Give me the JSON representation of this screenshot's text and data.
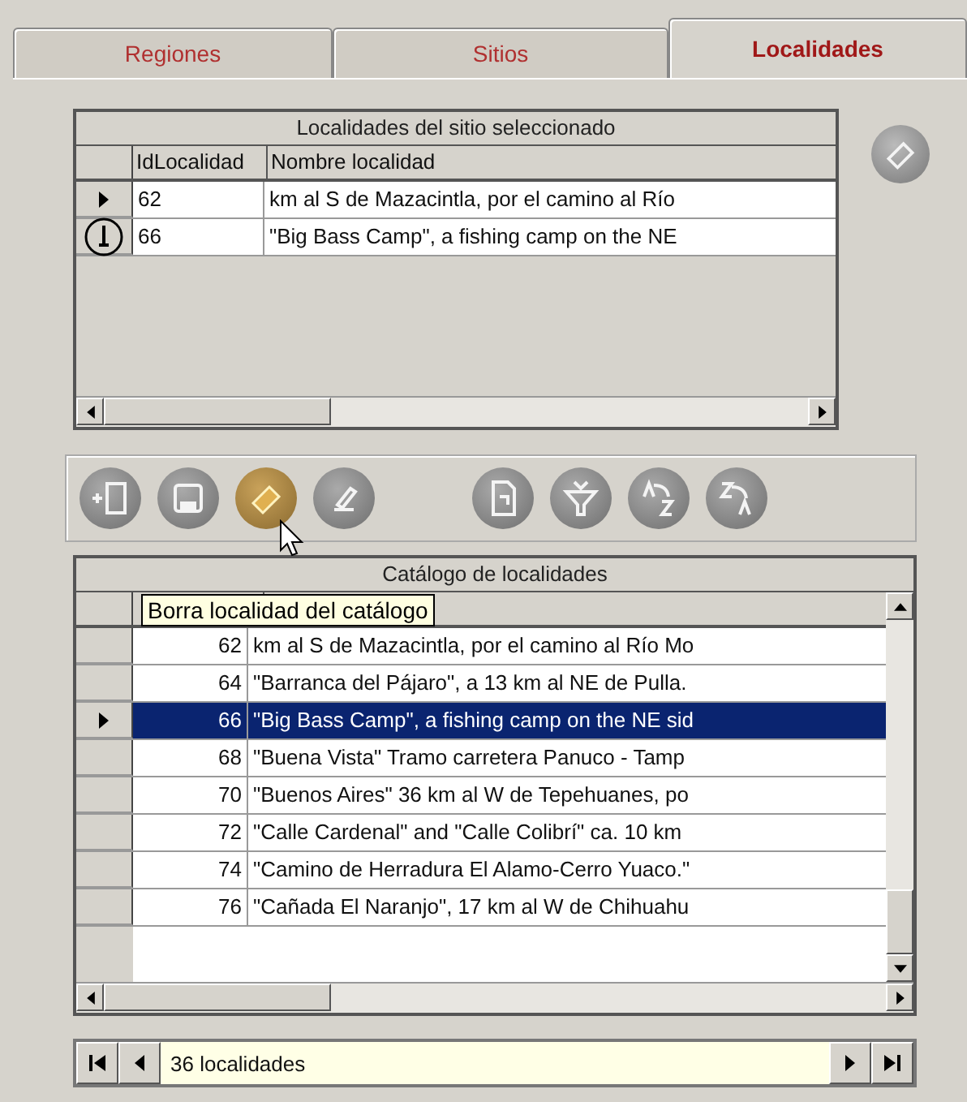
{
  "tabs": [
    {
      "label": "Regiones",
      "selected": false
    },
    {
      "label": "Sitios",
      "selected": false
    },
    {
      "label": "Localidades",
      "selected": true
    }
  ],
  "site_grid": {
    "title": "Localidades del sitio seleccionado",
    "columns": [
      "IdLocalidad",
      "Nombre localidad"
    ],
    "rows": [
      {
        "current": true,
        "cursor_over": false,
        "id": "62",
        "name": "km al S de Mazacintla, por el camino al Río"
      },
      {
        "current": false,
        "cursor_over": true,
        "id": "66",
        "name": "\"Big Bass Camp\", a fishing camp on the NE"
      }
    ]
  },
  "toolbar": [
    {
      "kind": "add",
      "hovered": false
    },
    {
      "kind": "save",
      "hovered": false
    },
    {
      "kind": "erase",
      "hovered": true
    },
    {
      "kind": "edit",
      "hovered": false
    },
    {
      "kind": "document",
      "hovered": false
    },
    {
      "kind": "filter",
      "hovered": false
    },
    {
      "kind": "sort_asc",
      "hovered": false
    },
    {
      "kind": "sort_desc",
      "hovered": false
    }
  ],
  "tooltip": "Borra localidad del catálogo",
  "catalog_grid": {
    "title": "Catálogo de localidades",
    "rows": [
      {
        "id": "62",
        "name": "km al S de Mazacintla, por el camino al Río Mo",
        "selected": false
      },
      {
        "id": "64",
        "name": "\"Barranca del Pájaro\", a 13 km al NE de Pulla.",
        "selected": false
      },
      {
        "id": "66",
        "name": "\"Big Bass Camp\", a fishing camp on the NE sid",
        "selected": true
      },
      {
        "id": "68",
        "name": "\"Buena Vista\" Tramo carretera Panuco - Tamp",
        "selected": false
      },
      {
        "id": "70",
        "name": "\"Buenos Aires\" 36 km al W de Tepehuanes, po",
        "selected": false
      },
      {
        "id": "72",
        "name": "\"Calle Cardenal\" and \"Calle Colibrí\" ca. 10 km",
        "selected": false
      },
      {
        "id": "74",
        "name": "\"Camino de Herradura El Alamo-Cerro Yuaco.\"",
        "selected": false
      },
      {
        "id": "76",
        "name": "\"Cañada El Naranjo\", 17 km al W de Chihuahu",
        "selected": false
      }
    ]
  },
  "navigator": {
    "value": "36 localidades"
  }
}
